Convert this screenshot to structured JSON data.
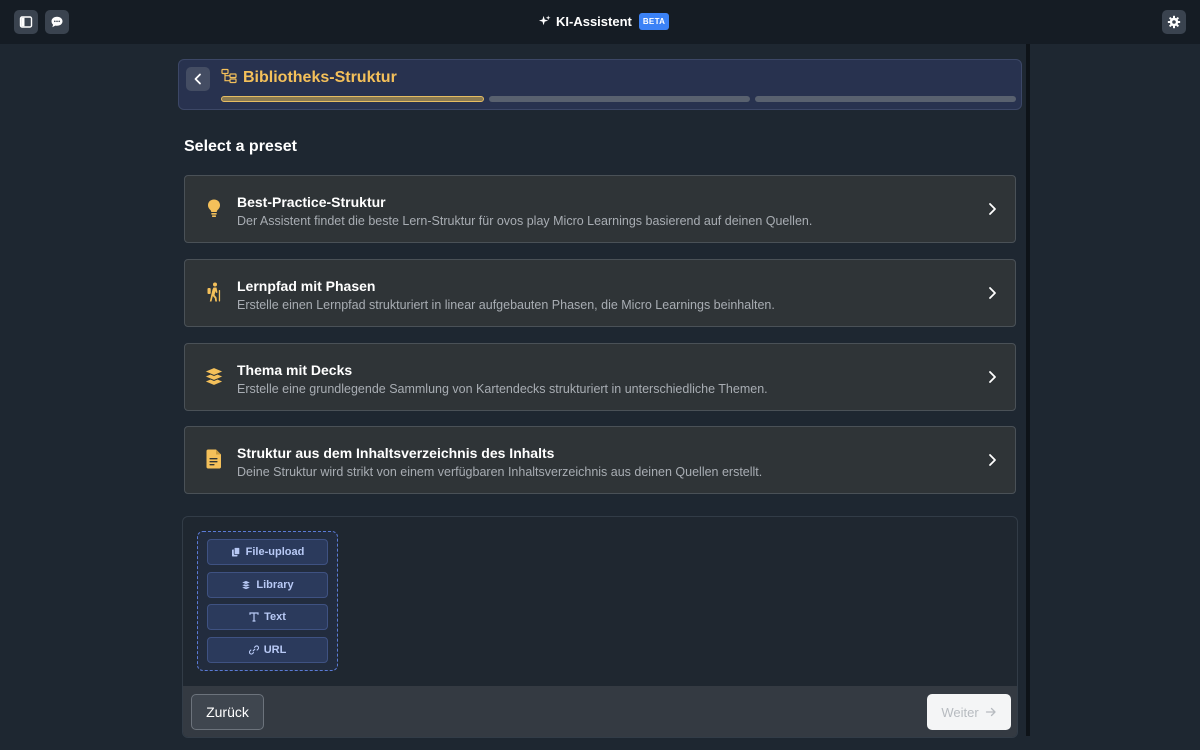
{
  "topbar": {
    "title": "KI-Assistent",
    "badge": "BETA",
    "icons": [
      "sidebar-toggle-icon",
      "chat-icon",
      "sparkle-icon",
      "settings-icon"
    ]
  },
  "header": {
    "title": "Bibliotheks-Struktur",
    "progress": {
      "current_step": 1,
      "total_steps": 3
    }
  },
  "section_title": "Select a preset",
  "presets": [
    {
      "title": "Best-Practice-Struktur",
      "description": "Der Assistent findet die beste Lern-Struktur für ovos play Micro Learnings basierend auf deinen Quellen.",
      "icon": "lightbulb-icon"
    },
    {
      "title": "Lernpfad mit Phasen",
      "description": "Erstelle einen Lernpfad strukturiert in linear aufgebauten Phasen, die Micro Learnings beinhalten.",
      "icon": "hiker-icon"
    },
    {
      "title": "Thema mit Decks",
      "description": "Erstelle eine grundlegende Sammlung von Kartendecks strukturiert in unterschiedliche Themen.",
      "icon": "layers-icon"
    },
    {
      "title": "Struktur aus dem Inhaltsverzeichnis des Inhalts",
      "description": "Deine Struktur wird strikt von einem verfügbaren Inhaltsverzeichnis aus deinen Quellen erstellt.",
      "icon": "document-icon"
    }
  ],
  "sources": [
    {
      "label": "File-upload",
      "icon": "files-icon"
    },
    {
      "label": "Library",
      "icon": "layers-icon"
    },
    {
      "label": "Text",
      "icon": "text-icon"
    },
    {
      "label": "URL",
      "icon": "link-icon"
    }
  ],
  "footer": {
    "back_label": "Zurück",
    "next_label": "Weiter"
  },
  "colors": {
    "background": "#1e2731",
    "accent_gold": "#f4c05a",
    "beta_blue": "#3b82f6",
    "source_blue": "#b8c9f5"
  }
}
